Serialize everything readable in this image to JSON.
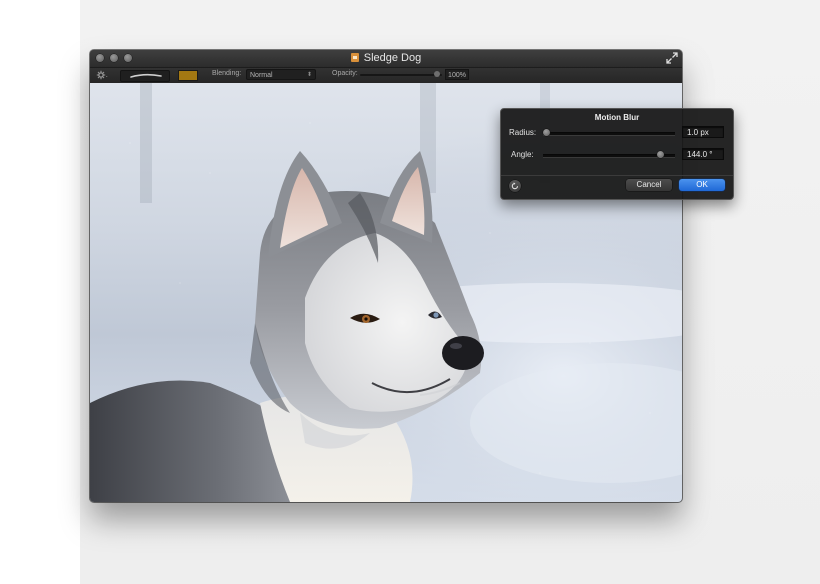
{
  "window": {
    "title": "Sledge Dog"
  },
  "toolbar": {
    "blending_label": "Blending:",
    "blending_value": "Normal",
    "opacity_label": "Opacity:",
    "opacity_value": "100%",
    "swatch_color": "#a37812"
  },
  "panel": {
    "title": "Motion Blur",
    "radius_label": "Radius:",
    "radius_value": "1.0 px",
    "angle_label": "Angle:",
    "angle_value": "144.0 °",
    "cancel_label": "Cancel",
    "ok_label": "OK",
    "accent_color": "#2a74de"
  },
  "icons": [
    "gear-icon",
    "fullscreen-icon",
    "document-icon",
    "reset-icon"
  ]
}
